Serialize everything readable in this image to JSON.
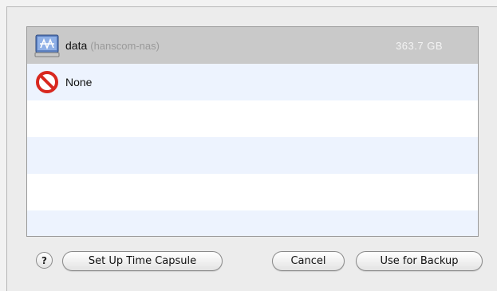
{
  "list": {
    "items": [
      {
        "name": "data",
        "host": "(hanscom-nas)",
        "size": "363.7 GB",
        "icon": "network-drive-icon",
        "selected": true
      },
      {
        "name": "None",
        "icon": "prohibited-icon",
        "selected": false
      }
    ]
  },
  "buttons": {
    "help_label": "?",
    "setup_label": "Set Up Time Capsule",
    "cancel_label": "Cancel",
    "use_label": "Use for Backup"
  },
  "colors": {
    "selection": "#c9c9c9",
    "alt_row": "#edf3fe",
    "prohibited_red": "#d8281f"
  }
}
